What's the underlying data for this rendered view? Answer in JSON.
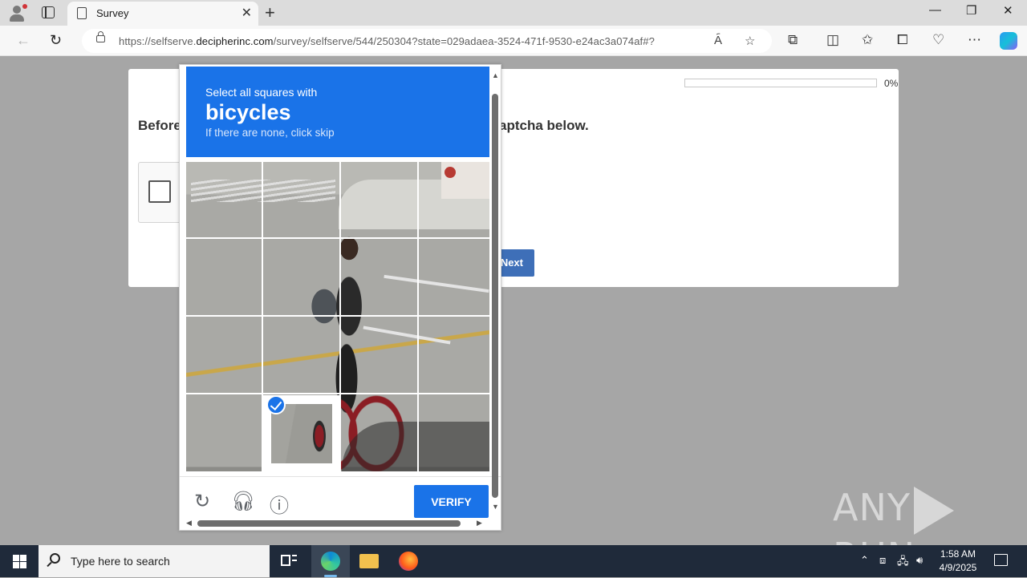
{
  "browser": {
    "tab_title": "Survey",
    "url_prefix": "https://selfserve.",
    "url_domain": "decipherinc.com",
    "url_path": "/survey/selfserve/544/250304?state=029adaea-3524-471f-9530-e24ac3a074af#?",
    "icons": {
      "back": "back-arrow-icon",
      "refresh": "refresh-icon",
      "read_aloud": "read-aloud-icon",
      "favorite": "star-icon",
      "extensions": "puzzle-icon",
      "split": "split-screen-icon",
      "favorites": "favorites-icon",
      "collections": "collections-icon",
      "performance": "heart-pulse-icon",
      "more": "ellipsis-icon",
      "copilot": "copilot-icon"
    }
  },
  "survey": {
    "progress_percent": 0,
    "progress_label": "0%",
    "question_left": "Before",
    "question_right": "aptcha below.",
    "next_label": "Next"
  },
  "captcha": {
    "instruction": "Select all squares with",
    "target": "bicycles",
    "hint": "If there are none, click skip",
    "grid_size": "4x4",
    "selected_tiles": [
      "row4-col2"
    ],
    "verify_label": "VERIFY",
    "accent_color": "#1a73e8",
    "footer_icons": [
      "reload-icon",
      "audio-icon",
      "info-icon"
    ]
  },
  "watermark": {
    "left": "ANY",
    "right": "RUN"
  },
  "taskbar": {
    "search_placeholder": "Type here to search",
    "time": "1:58 AM",
    "date": "4/9/2025",
    "apps": [
      "task-view-icon",
      "edge-icon",
      "file-explorer-icon",
      "firefox-icon"
    ]
  }
}
